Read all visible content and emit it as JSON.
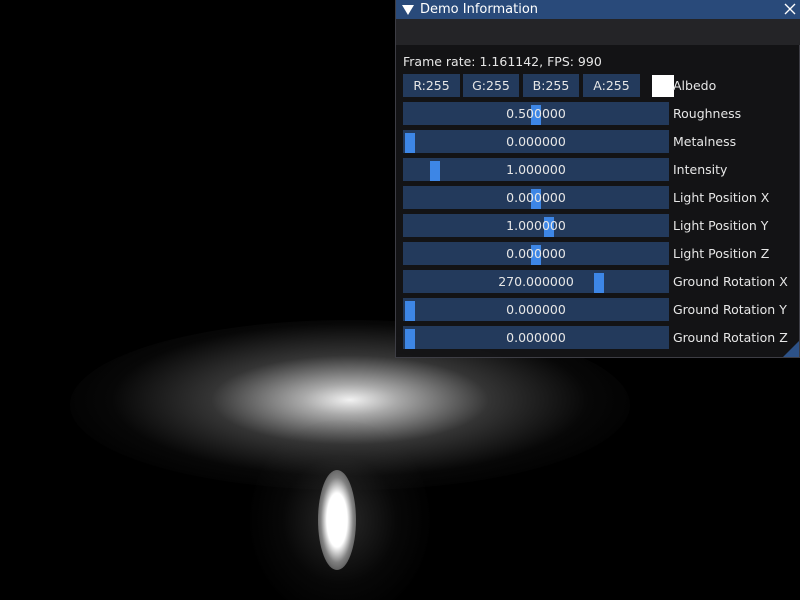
{
  "scene": {
    "background_color": "#000000"
  },
  "panel": {
    "title": "Demo Information",
    "frame_rate_text": "Frame rate: 1.161142, FPS: 990",
    "colors": {
      "title_bg": "#294a7a",
      "frame_bg": "#233a5c",
      "grab": "#3d86e6"
    },
    "albedo": {
      "label": "Albedo",
      "r": "R:255",
      "g": "G:255",
      "b": "B:255",
      "a": "A:255",
      "swatch_color": "#ffffff"
    },
    "sliders": [
      {
        "label": "Roughness",
        "value": "0.500000",
        "fill": 0.5
      },
      {
        "label": "Metalness",
        "value": "0.000000",
        "fill": 0.0
      },
      {
        "label": "Intensity",
        "value": "1.000000",
        "fill": 0.1
      },
      {
        "label": "Light Position X",
        "value": "0.000000",
        "fill": 0.5
      },
      {
        "label": "Light Position Y",
        "value": "1.000000",
        "fill": 0.55
      },
      {
        "label": "Light Position Z",
        "value": "0.000000",
        "fill": 0.5
      },
      {
        "label": "Ground Rotation X",
        "value": "270.000000",
        "fill": 0.75
      },
      {
        "label": "Ground Rotation Y",
        "value": "0.000000",
        "fill": 0.0
      },
      {
        "label": "Ground Rotation Z",
        "value": "0.000000",
        "fill": 0.0
      }
    ]
  }
}
